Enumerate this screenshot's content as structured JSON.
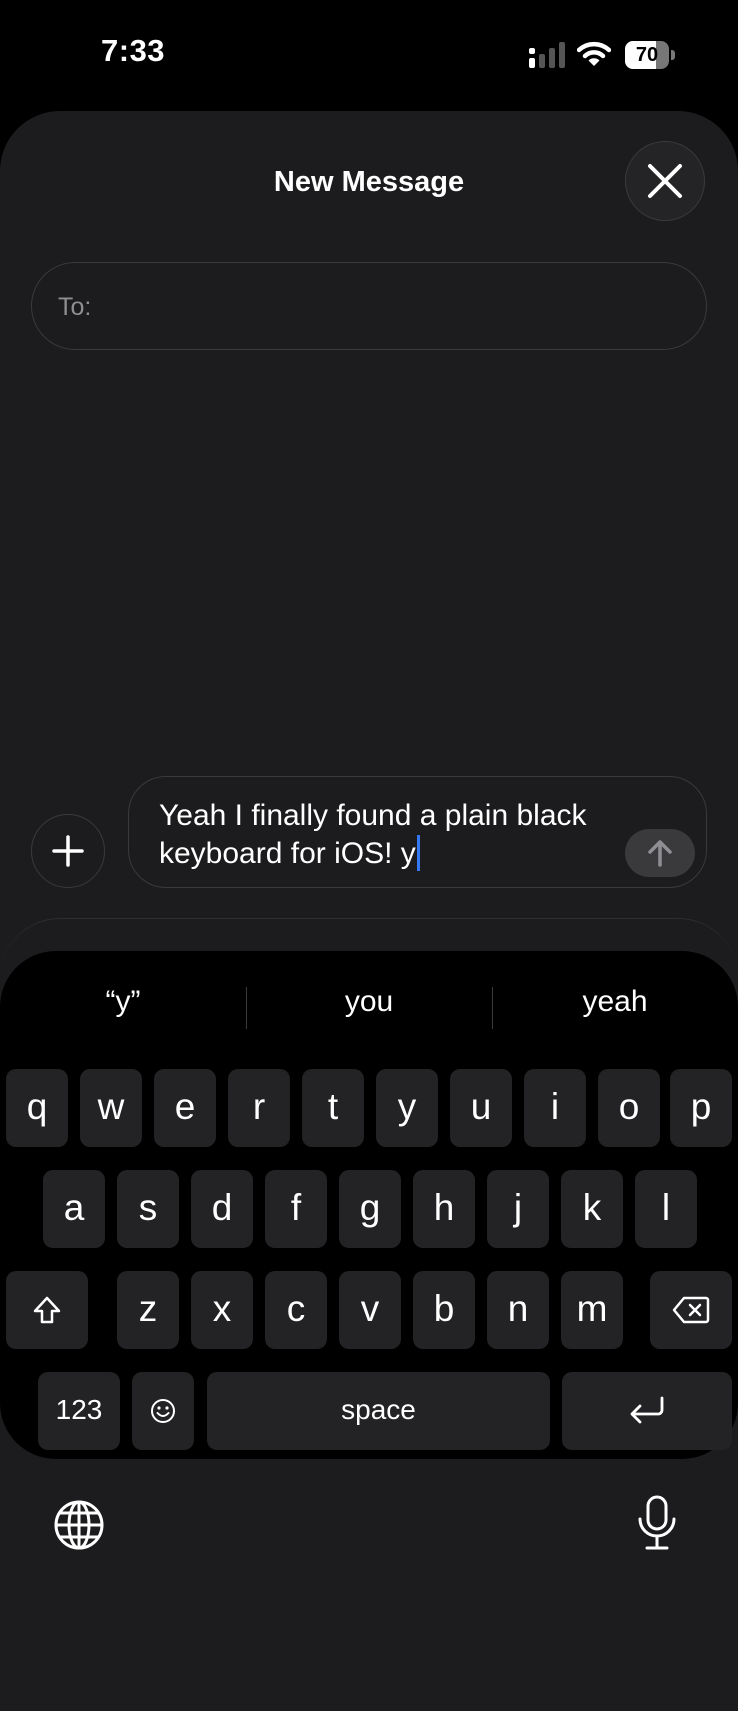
{
  "status": {
    "time": "7:33",
    "battery": "70",
    "battery_level": 0.7
  },
  "compose": {
    "title": "New Message",
    "to_label": "To:",
    "message_text": "Yeah I finally found a plain black keyboard for iOS! y"
  },
  "keyboard": {
    "suggestions": [
      "“y”",
      "you",
      "yeah"
    ],
    "row1": [
      "q",
      "w",
      "e",
      "r",
      "t",
      "y",
      "u",
      "i",
      "o",
      "p"
    ],
    "row2": [
      "a",
      "s",
      "d",
      "f",
      "g",
      "h",
      "j",
      "k",
      "l"
    ],
    "row3": [
      "z",
      "x",
      "c",
      "v",
      "b",
      "n",
      "m"
    ],
    "numbers_label": "123",
    "space_label": "space"
  },
  "icons": [
    "signal-icon",
    "wifi-icon",
    "close-icon",
    "plus-icon",
    "send-arrow-icon",
    "shift-icon",
    "backspace-icon",
    "emoji-icon",
    "return-icon",
    "globe-icon",
    "mic-icon"
  ]
}
